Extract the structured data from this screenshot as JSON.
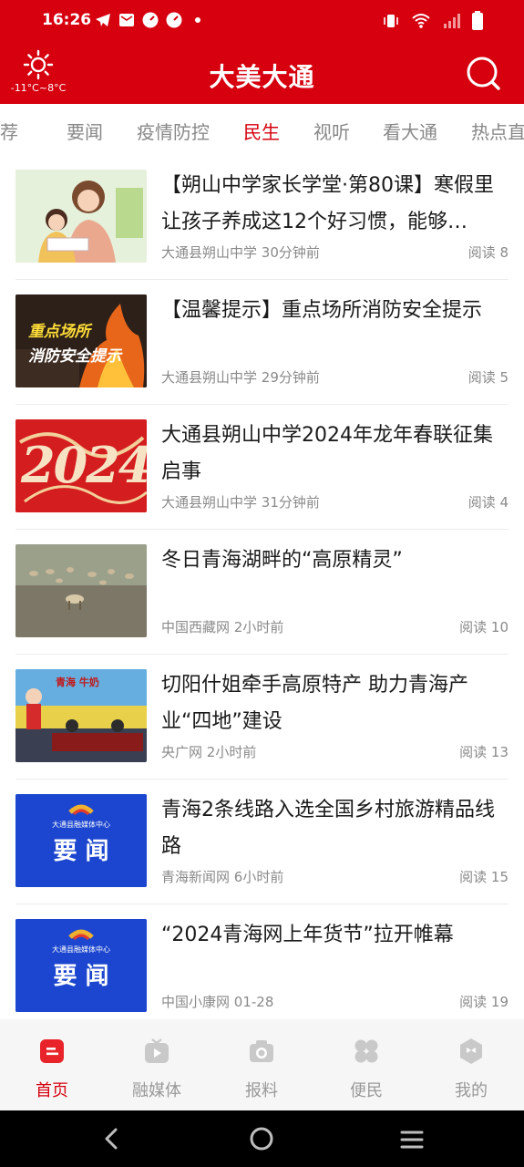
{
  "status_bar": {
    "time": "16:26"
  },
  "header": {
    "weather_temp": "-11°C~8°C",
    "title": "大美大通",
    "icons": [
      "weather-sun-icon",
      "search-icon"
    ]
  },
  "tabs": [
    {
      "label": "推荐",
      "active": false
    },
    {
      "label": "要闻",
      "active": false
    },
    {
      "label": "疫情防控",
      "active": false
    },
    {
      "label": "民生",
      "active": true
    },
    {
      "label": "视听",
      "active": false
    },
    {
      "label": "看大通",
      "active": false
    },
    {
      "label": "热点直",
      "active": false
    }
  ],
  "news": [
    {
      "title": "【朔山中学家长学堂·第80课】寒假里让孩子养成这12个好习惯，能够…",
      "source": "大通县朔山中学",
      "time": "30分钟前",
      "reads": "阅读 8",
      "thumb": "illustration-mother-child"
    },
    {
      "title": "【温馨提示】重点场所消防安全提示",
      "source": "大通县朔山中学",
      "time": "29分钟前",
      "reads": "阅读 5",
      "thumb": "fire-safety-poster",
      "thumb_text": [
        "重点场所",
        "消防安全提示"
      ]
    },
    {
      "title": "大通县朔山中学2024年龙年春联征集启事",
      "source": "大通县朔山中学",
      "time": "31分钟前",
      "reads": "阅读 4",
      "thumb": "red-2024-dragon",
      "thumb_text": [
        "2024"
      ]
    },
    {
      "title": "冬日青海湖畔的“高原精灵”",
      "source": "中国西藏网",
      "time": "2小时前",
      "reads": "阅读 10",
      "thumb": "antelopes-grassland"
    },
    {
      "title": "切阳什姐牵手高原特产 助力青海产业“四地”建设",
      "source": "央广网",
      "time": "2小时前",
      "reads": "阅读 13",
      "thumb": "livestream-event",
      "thumb_text": [
        "青海 牛奶"
      ]
    },
    {
      "title": "青海2条线路入选全国乡村旅游精品线路",
      "source": "青海新闻网",
      "time": "6小时前",
      "reads": "阅读 15",
      "thumb": "blue-news-card",
      "thumb_text": [
        "大通县融媒体中心",
        "要 闻"
      ]
    },
    {
      "title": "“2024青海网上年货节”拉开帷幕",
      "source": "中国小康网",
      "time": "01-28",
      "reads": "阅读 19",
      "thumb": "blue-news-card",
      "thumb_text": [
        "大通县融媒体中心",
        "要 闻"
      ]
    }
  ],
  "bottom_nav": [
    {
      "label": "首页",
      "icon": "home-icon",
      "active": true
    },
    {
      "label": "融媒体",
      "icon": "media-play-icon",
      "active": false
    },
    {
      "label": "报料",
      "icon": "camera-icon",
      "active": false
    },
    {
      "label": "便民",
      "icon": "services-grid-icon",
      "active": false
    },
    {
      "label": "我的",
      "icon": "profile-icon",
      "active": false
    }
  ],
  "colors": {
    "brand_red": "#d6000f",
    "text": "#1a1a1a",
    "muted": "#8a8a8a"
  }
}
